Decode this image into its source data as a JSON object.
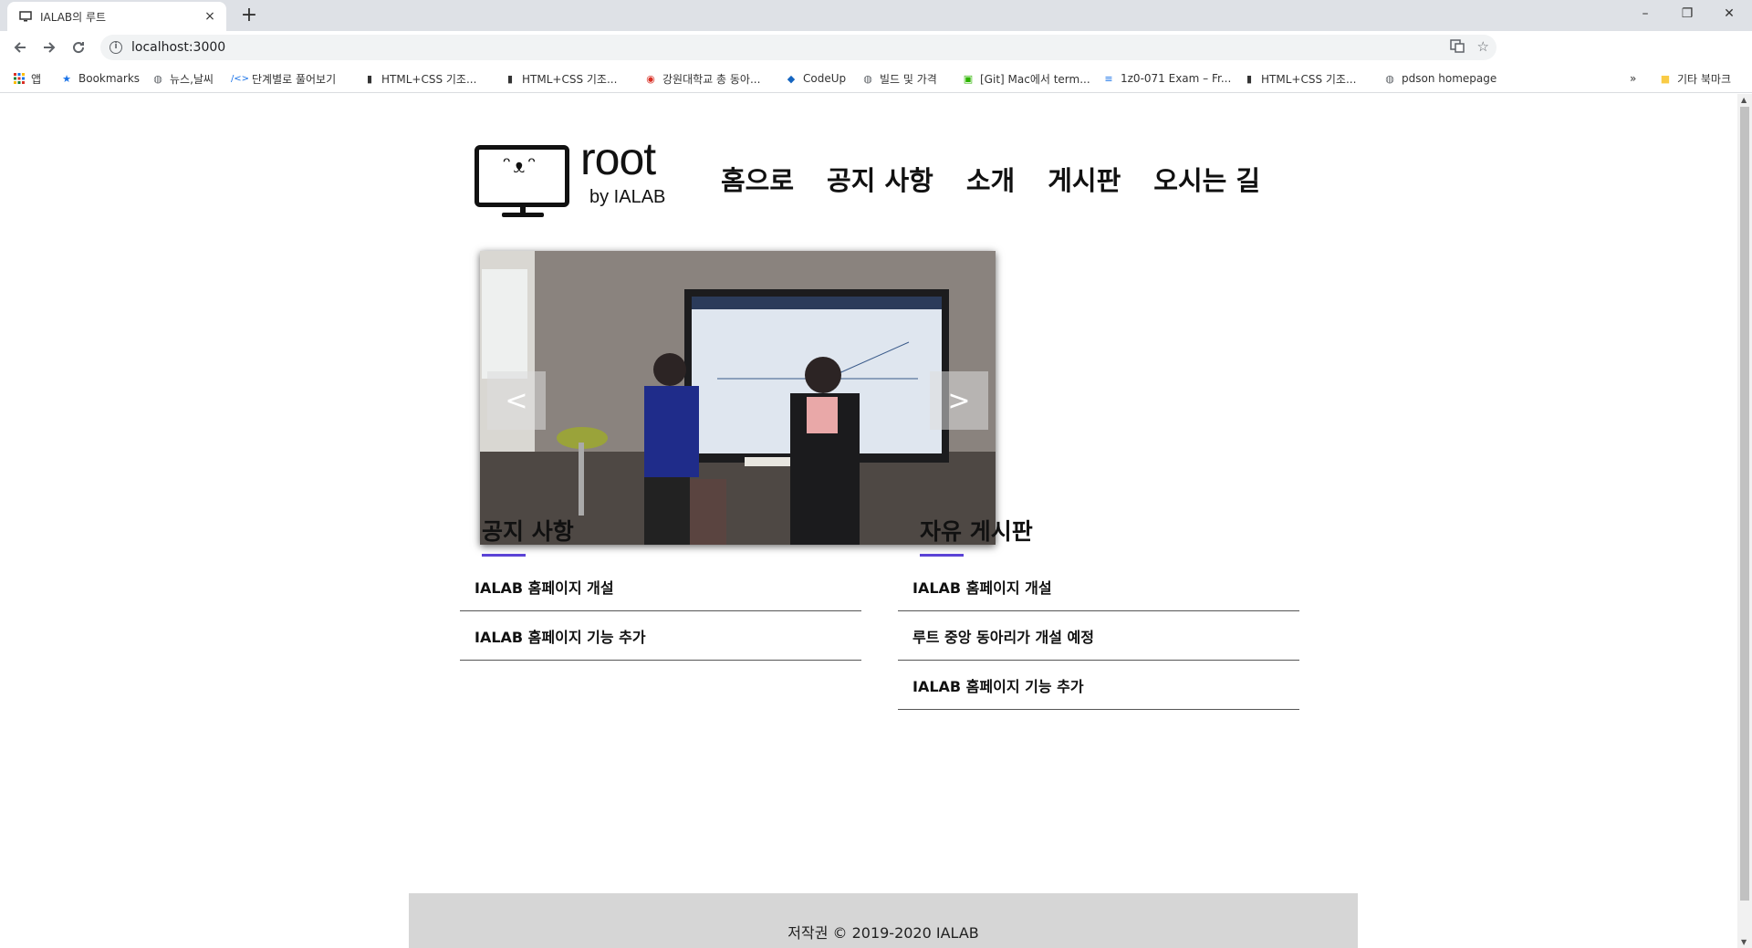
{
  "browser": {
    "tab_title": "IALAB의 루트",
    "tab_close": "×",
    "new_tab": "+",
    "url": "localhost:3000",
    "window_controls": {
      "minimize": "–",
      "restore": "❐",
      "close": "✕"
    },
    "bookmarks": [
      {
        "label": "앱",
        "icon": "apps-grid-icon"
      },
      {
        "label": "Bookmarks",
        "icon": "star-icon"
      },
      {
        "label": "뉴스,날씨",
        "icon": "globe-icon"
      },
      {
        "label": "단계별로 풀어보기",
        "icon": "code-icon"
      },
      {
        "label": "HTML+CSS 기조...",
        "icon": "page-icon"
      },
      {
        "label": "HTML+CSS 기조...",
        "icon": "page-icon"
      },
      {
        "label": "강원대학교 총 동아...",
        "icon": "circle-logo-icon"
      },
      {
        "label": "CodeUp",
        "icon": "codeup-icon"
      },
      {
        "label": "빌드 및 가격",
        "icon": "globe-icon"
      },
      {
        "label": "[Git] Mac에서 term...",
        "icon": "blog-icon"
      },
      {
        "label": "1z0-071 Exam – Fr...",
        "icon": "list-icon"
      },
      {
        "label": "HTML+CSS 기조...",
        "icon": "page-icon"
      },
      {
        "label": "pdson homepage",
        "icon": "globe-icon"
      }
    ],
    "bookmarks_overflow": "»",
    "other_bookmarks": "기타 북마크"
  },
  "site": {
    "logo_word": "root",
    "logo_by": "by IALAB",
    "logo_face": "ᵔᴥᵔ",
    "nav": [
      "홈으로",
      "공지 사항",
      "소개",
      "게시판",
      "오시는 길"
    ],
    "slider": {
      "prev": "<",
      "next": ">"
    },
    "notice_board": {
      "title": "공지 사항",
      "items": [
        "IALAB 홈페이지 개설",
        "IALAB 홈페이지 기능 추가"
      ]
    },
    "free_board": {
      "title": "자유 게시판",
      "items": [
        "IALAB 홈페이지 개설",
        "루트 중앙 동아리가 개설 예정",
        "IALAB 홈페이지 기능 추가"
      ]
    },
    "footer": "저작권 © 2019-2020 IALAB"
  },
  "colors": {
    "accent": "#5b43d6",
    "footer_bg": "#d6d6d6",
    "chrome_bg": "#dee1e6"
  }
}
